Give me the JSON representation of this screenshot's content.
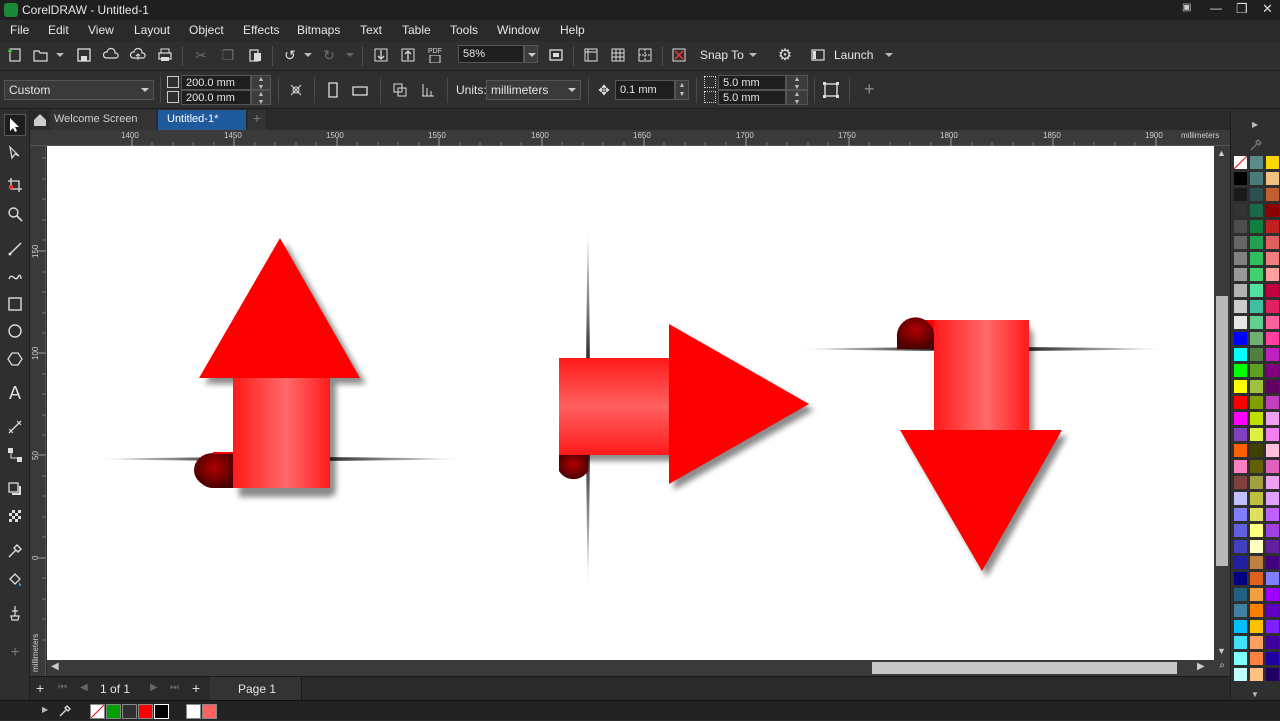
{
  "app": {
    "title": "CorelDRAW - Untitled-1",
    "window_buttons": [
      "▣",
      "—",
      "❐",
      "✕"
    ]
  },
  "menu": [
    "File",
    "Edit",
    "View",
    "Layout",
    "Object",
    "Effects",
    "Bitmaps",
    "Text",
    "Table",
    "Tools",
    "Window",
    "Help"
  ],
  "toolbar": {
    "zoom_value": "58%",
    "snap_label": "Snap To",
    "launch_label": "Launch",
    "pdf_label": "PDF"
  },
  "properties": {
    "page_size": "Custom",
    "width": "200.0 mm",
    "height": "200.0 mm",
    "units_label": "Units:",
    "units_value": "millimeters",
    "nudge": "0.1 mm",
    "dup_x": "5.0 mm",
    "dup_y": "5.0 mm",
    "add_label": "+"
  },
  "tabs": [
    {
      "label": "Welcome Screen",
      "active": false
    },
    {
      "label": "Untitled-1*",
      "active": true
    }
  ],
  "ruler": {
    "h_ticks": [
      "1400",
      "1450",
      "1500",
      "1550",
      "1600",
      "1650",
      "1700",
      "1750",
      "1800",
      "1850",
      "1900"
    ],
    "h_unit": "millimeters",
    "v_ticks": [
      "150",
      "100",
      "50",
      "0"
    ],
    "v_unit": "millimeters"
  },
  "pages": {
    "current": "1",
    "of_label": "of",
    "total": "1",
    "page_tab": "Page 1"
  },
  "palette_colors": [
    [
      "#ffffff",
      "#5a8a8a",
      "#ffd700"
    ],
    [
      "#000000",
      "#4a7a7a",
      "#f0c080"
    ],
    [
      "#1a1a1a",
      "#2a5050",
      "#c06030"
    ],
    [
      "#333333",
      "#1a6a4a",
      "#8b0000"
    ],
    [
      "#4d4d4d",
      "#108040",
      "#c02020"
    ],
    [
      "#666666",
      "#20a050",
      "#e06060"
    ],
    [
      "#808080",
      "#30c060",
      "#f08080"
    ],
    [
      "#999999",
      "#40d070",
      "#ffa0a0"
    ],
    [
      "#b3b3b3",
      "#50e0a0",
      "#c00040"
    ],
    [
      "#cccccc",
      "#40c0a0",
      "#e02060"
    ],
    [
      "#e6e6e6",
      "#60d090",
      "#ff60a0"
    ],
    [
      "#0000ff",
      "#70b070",
      "#ff40a0"
    ],
    [
      "#00ffff",
      "#508040",
      "#c020c0"
    ],
    [
      "#00ff00",
      "#60a020",
      "#800080"
    ],
    [
      "#ffff00",
      "#a0c040",
      "#600060"
    ],
    [
      "#ff0000",
      "#80a000",
      "#c040c0"
    ],
    [
      "#ff00ff",
      "#c0e000",
      "#f0a0f0"
    ],
    [
      "#8040c0",
      "#e0f040",
      "#f080f0"
    ],
    [
      "#ff6000",
      "#404000",
      "#ffc0e0"
    ],
    [
      "#ff80c0",
      "#606000",
      "#e060c0"
    ],
    [
      "#804040",
      "#a0a040",
      "#f0a0f0"
    ],
    [
      "#c0c0ff",
      "#c0c040",
      "#e0a0ff"
    ],
    [
      "#8080ff",
      "#e0e060",
      "#c060ff"
    ],
    [
      "#6060e0",
      "#ffff80",
      "#a040e0"
    ],
    [
      "#4040c0",
      "#ffffc0",
      "#6020a0"
    ],
    [
      "#2020a0",
      "#c08040",
      "#400080"
    ],
    [
      "#000080",
      "#e06020",
      "#8080ff"
    ],
    [
      "#206080",
      "#f0a040",
      "#a000ff"
    ],
    [
      "#4080a0",
      "#ff8000",
      "#6000c0"
    ],
    [
      "#00c0ff",
      "#ffc000",
      "#8020ff"
    ],
    [
      "#40e0ff",
      "#ffa060",
      "#4000a0"
    ],
    [
      "#80ffff",
      "#ff8040",
      "#2000a0"
    ],
    [
      "#c0ffff",
      "#ffc080",
      "#200060"
    ]
  ],
  "status_swatches": [
    "#ffffff",
    "#00a000",
    "#303030",
    "#ff0000",
    "#000000",
    "#ffffff",
    "#ff6060"
  ]
}
